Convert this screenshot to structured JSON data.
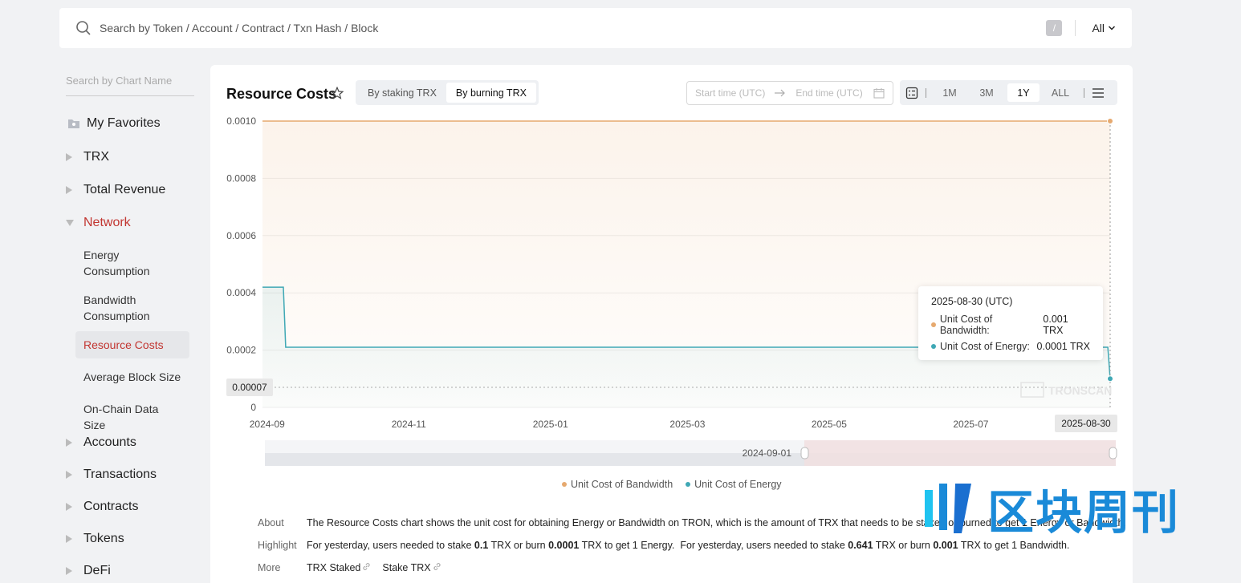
{
  "search": {
    "placeholder": "Search by Token / Account / Contract / Txn Hash / Block",
    "shortcut": "/",
    "filter": "All"
  },
  "sidebar": {
    "search_placeholder": "Search by Chart Name",
    "favorites": "My Favorites",
    "items": [
      "TRX",
      "Total Revenue",
      "Network",
      "Accounts",
      "Transactions",
      "Contracts",
      "Tokens",
      "DeFi"
    ],
    "network_sub": [
      "Energy Consumption",
      "Bandwidth Consumption",
      "Resource Costs",
      "Average Block Size",
      "On-Chain Data Size"
    ]
  },
  "card": {
    "title": "Resource Costs",
    "modes": [
      "By staking TRX",
      "By burning TRX"
    ],
    "selected_mode": "By burning TRX",
    "start_placeholder": "Start time (UTC)",
    "end_placeholder": "End time (UTC)",
    "periods": [
      "1M",
      "3M",
      "1Y",
      "ALL"
    ],
    "selected_period": "1Y"
  },
  "colors": {
    "accent": "#c23631",
    "bandwidth": "#e6a96f",
    "energy": "#3fa8b5"
  },
  "chart_data": {
    "type": "line",
    "y_ticks": [
      "0.0010",
      "0.0008",
      "0.0006",
      "0.0004",
      "0.0002",
      "0"
    ],
    "x_ticks": [
      "2024-09",
      "2024-11",
      "2025-01",
      "2025-03",
      "2025-05",
      "2025-07"
    ],
    "ylim": [
      0,
      0.001
    ],
    "crosshair_y_label": "0.00007",
    "crosshair_x_label": "2025-08-30",
    "slider_start_label": "2024-09-01",
    "series": [
      {
        "name": "Unit Cost of Bandwidth",
        "points": [
          [
            "2024-08-30",
            0.001
          ],
          [
            "2025-08-30",
            0.001
          ]
        ]
      },
      {
        "name": "Unit Cost of Energy",
        "points": [
          [
            "2024-08-30",
            0.00042
          ],
          [
            "2024-09-08",
            0.00042
          ],
          [
            "2024-09-09",
            0.00021
          ],
          [
            "2025-08-29",
            0.00021
          ],
          [
            "2025-08-30",
            0.0001
          ]
        ]
      }
    ],
    "legend": [
      "Unit Cost of Bandwidth",
      "Unit Cost of Energy"
    ]
  },
  "tooltip": {
    "date": "2025-08-30 (UTC)",
    "rows": [
      {
        "label": "Unit Cost of Bandwidth:",
        "value": "0.001 TRX"
      },
      {
        "label": "Unit Cost of Energy:",
        "value": "0.0001 TRX"
      }
    ]
  },
  "watermark_brand": "TRONSCAN",
  "overlay_watermark": "区块周刊",
  "info": {
    "about_label": "About",
    "about_text": "The Resource Costs chart shows the unit cost for obtaining Energy or Bandwidth on TRON, which is the amount of TRX that needs to be staked or burned to get 1 Energy or Bandwidth.",
    "highlight_label": "Highlight",
    "h1": "For yesterday, users needed to stake ",
    "h1v": "0.1",
    "h2": " TRX or burn ",
    "h2v": "0.0001",
    "h3": " TRX to get 1 Energy.  For yesterday, users needed to stake ",
    "h3v": "0.641",
    "h4": " TRX or burn ",
    "h4v": "0.001",
    "h5": " TRX to get 1 Bandwidth.",
    "more_label": "More",
    "links": [
      "TRX Staked",
      "Stake TRX"
    ]
  }
}
